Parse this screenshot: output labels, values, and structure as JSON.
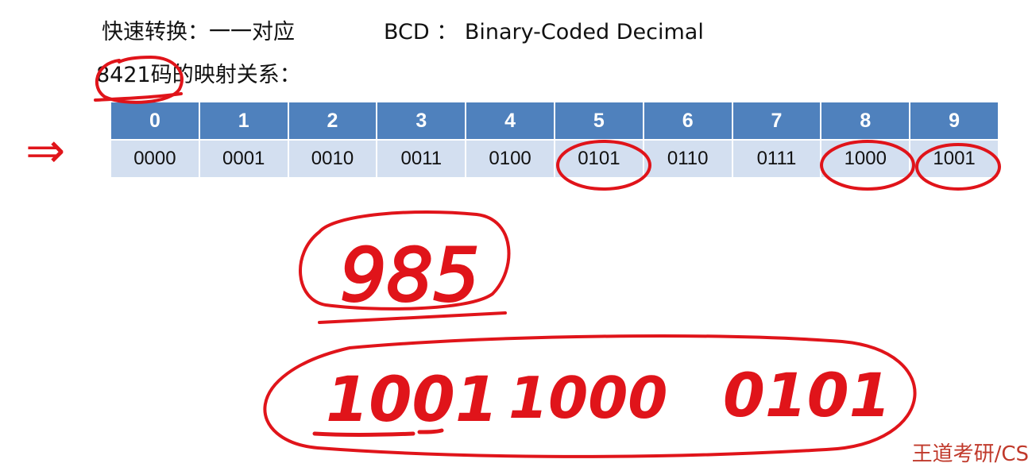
{
  "header": {
    "quick_convert": "快速转换：一一对应",
    "bcd_def": "BCD ： Binary-Coded Decimal"
  },
  "subtitle": {
    "code": "8421",
    "rest": "码的映射关系："
  },
  "table": {
    "headers": [
      "0",
      "1",
      "2",
      "3",
      "4",
      "5",
      "6",
      "7",
      "8",
      "9"
    ],
    "codes": [
      "0000",
      "0001",
      "0010",
      "0011",
      "0100",
      "0101",
      "0110",
      "0111",
      "1000",
      "1001"
    ]
  },
  "annotations": {
    "arrow": "⇒",
    "number": "985",
    "groups": [
      "1001",
      "1000",
      "0101"
    ]
  },
  "watermark": "王道考研/CS",
  "colors": {
    "header_bg": "#4f81bd",
    "cell_bg": "#d3dff0",
    "ink": "#e0141a"
  }
}
